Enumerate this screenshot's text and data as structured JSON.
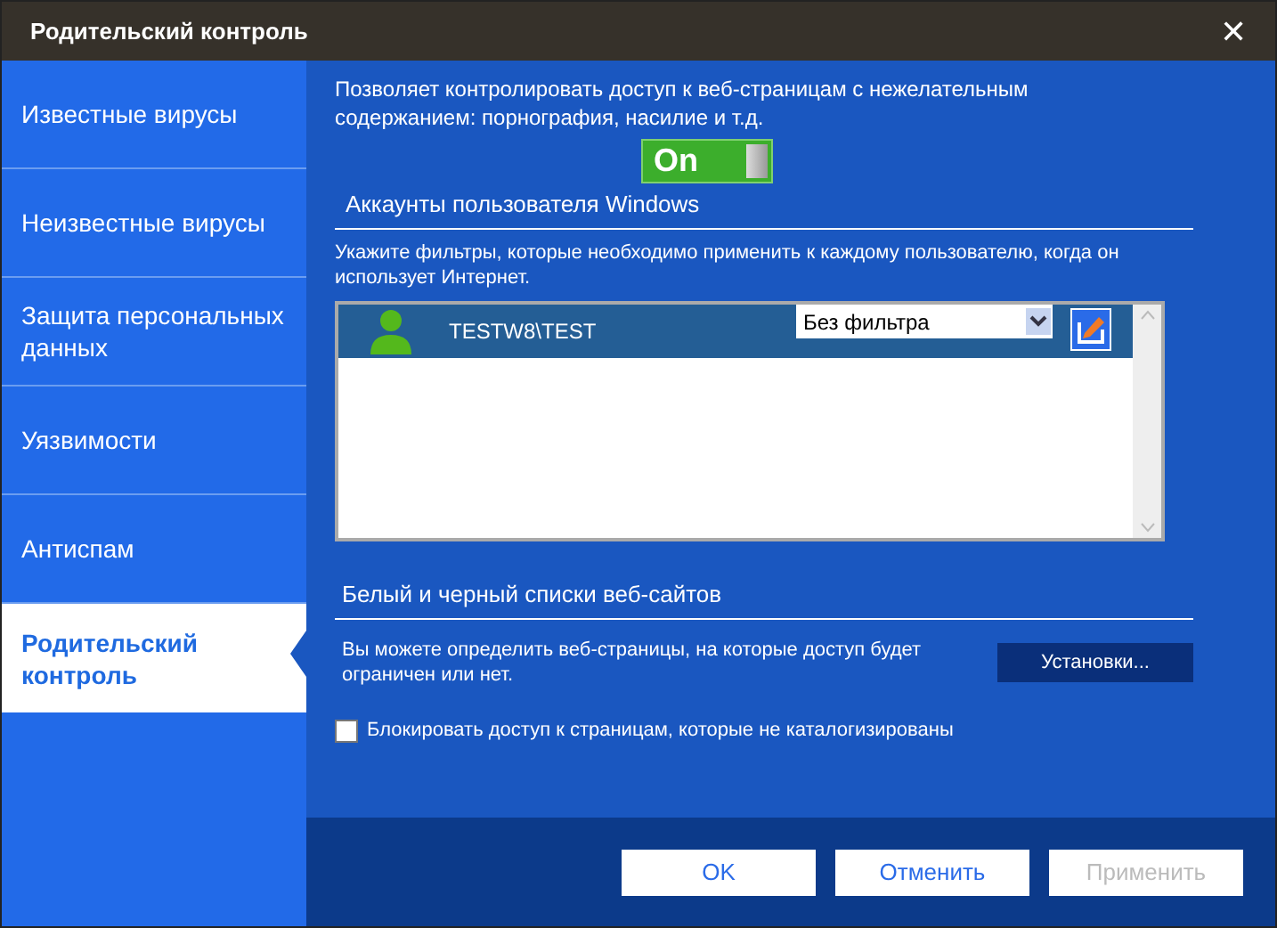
{
  "window": {
    "title": "Родительский контроль",
    "close": "✕"
  },
  "sidebar": {
    "items": [
      {
        "label": "Известные вирусы",
        "selected": false
      },
      {
        "label": "Неизвестные вирусы",
        "selected": false
      },
      {
        "label": "Защита персональных данных",
        "selected": false
      },
      {
        "label": "Уязвимости",
        "selected": false
      },
      {
        "label": "Антиспам",
        "selected": false
      },
      {
        "label": "Родительский контроль",
        "selected": true
      }
    ]
  },
  "intro": "Позволяет контролировать доступ к веб-страницам с нежелательным содержанием: порнография, насилие и т.д.",
  "toggle": {
    "label": "On",
    "on": true
  },
  "accounts": {
    "heading": "Аккаунты пользователя Windows",
    "hint": "Укажите фильтры, которые необходимо применить к каждому пользователю, когда он использует Интернет.",
    "users": [
      {
        "name": "TESTW8\\TEST",
        "filter": "Без фильтра",
        "selected": true
      }
    ]
  },
  "lists": {
    "heading": "Белый и черный списки веб-сайтов",
    "text": "Вы можете определить веб-страницы, на которые доступ будет ограничен или нет.",
    "button": "Установки..."
  },
  "block_uncategorized": {
    "label": "Блокировать доступ к страницам, которые не каталогизированы",
    "checked": false
  },
  "buttons": [
    {
      "label": "OK",
      "disabled": false
    },
    {
      "label": "Отменить",
      "disabled": false
    },
    {
      "label": "Применить",
      "disabled": true
    }
  ]
}
